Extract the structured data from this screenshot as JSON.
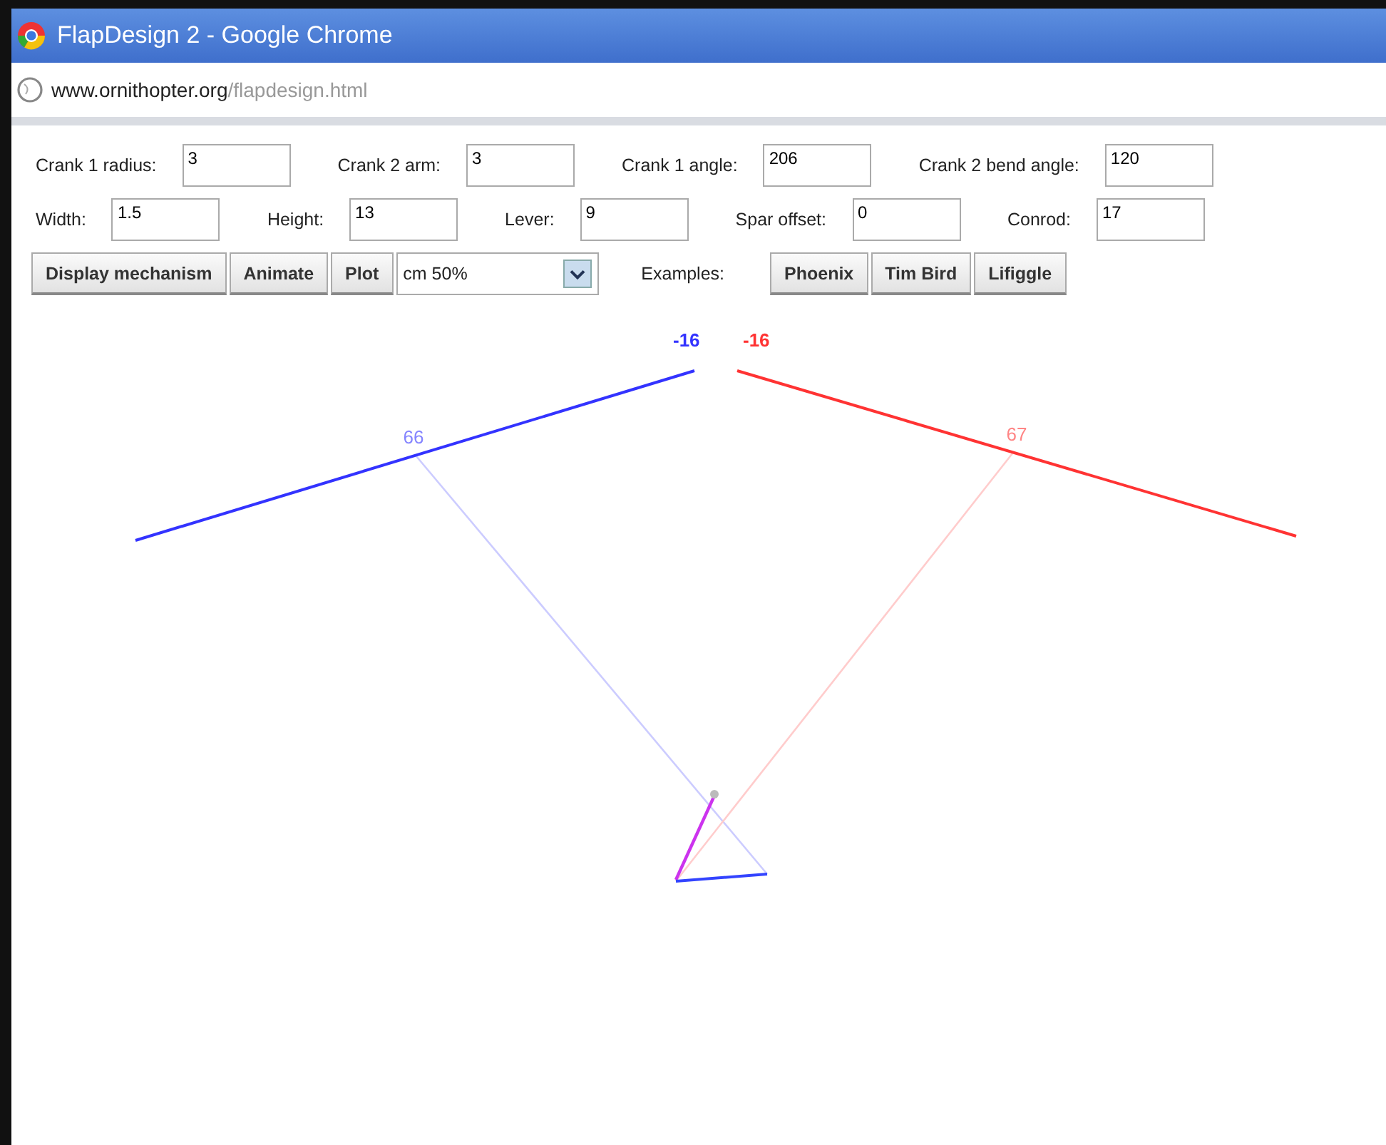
{
  "window": {
    "title": "FlapDesign 2 - Google Chrome"
  },
  "address_bar": {
    "host": "www.ornithopter.org",
    "path": "/flapdesign.html"
  },
  "fields": [
    [
      {
        "label": "Crank 1 radius:",
        "value": "3"
      },
      {
        "label": "Crank 2 arm:",
        "value": "3"
      },
      {
        "label": "Crank 1 angle:",
        "value": "206"
      },
      {
        "label": "Crank 2 bend angle:",
        "value": "120"
      }
    ],
    [
      {
        "label": "Width:",
        "value": "1.5"
      },
      {
        "label": "Height:",
        "value": "13"
      },
      {
        "label": "Lever:",
        "value": "9"
      },
      {
        "label": "Spar offset:",
        "value": "0"
      },
      {
        "label": "Conrod:",
        "value": "17"
      }
    ]
  ],
  "buttons": [
    "Display mechanism",
    "Animate",
    "Plot"
  ],
  "scale_select": {
    "value": "cm 50%"
  },
  "examples": {
    "label": "Examples:",
    "buttons": [
      "Phoenix",
      "Tim Bird",
      "Lifiggle"
    ]
  },
  "mechanism": {
    "wings": [
      {
        "kind": "left",
        "angle": "-16",
        "spar_value": "66",
        "color": "#3333ff"
      },
      {
        "kind": "right",
        "angle": "-16",
        "spar_value": "67",
        "color": "#ff3333"
      }
    ]
  }
}
